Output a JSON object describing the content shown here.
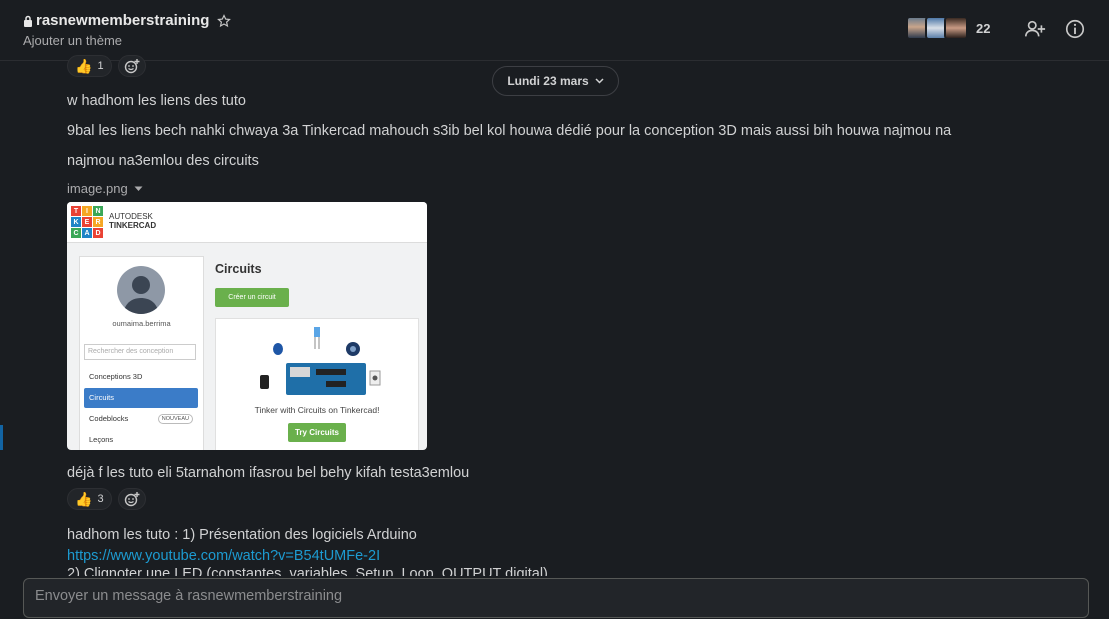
{
  "header": {
    "channel_name": "rasnewmemberstraining",
    "topic": "Ajouter un thème",
    "member_count": "22",
    "icons": [
      "lock-icon",
      "star-icon",
      "add-member-icon",
      "info-icon"
    ]
  },
  "date_divider": "Lundi 23 mars",
  "reactions_top": {
    "emoji": "thumbs-up",
    "count": "1"
  },
  "messages": [
    "w hadhom les liens des tuto",
    "9bal les liens bech nahki chwaya 3a Tinkercad mahouch s3ib bel kol houwa dédié pour la conception 3D mais aussi bih houwa najmou na",
    "najmou na3emlou des circuits",
    "déjà f les tuto eli 5tarnahom ifasrou bel behy kifah testa3emlou",
    "hadhom les tuto : 1) Présentation des logiciels Arduino",
    "2) Clignoter une LED (constantes, variables, Setup, Loop, OUTPUT digital)"
  ],
  "link": "https://www.youtube.com/watch?v=B54tUMFe-2I",
  "attachment": {
    "file_name": "image.png",
    "tinkercad": {
      "logo_letters": [
        "T",
        "I",
        "N",
        "K",
        "E",
        "R",
        "C",
        "A",
        "D"
      ],
      "brand_top": "AUTODESK",
      "brand_bottom": "TINKERCAD",
      "username": "oumaima.berrima",
      "search_placeholder": "Rechercher des conception",
      "nav": [
        "Conceptions 3D",
        "Circuits",
        "Codeblocks",
        "Leçons"
      ],
      "badge": "NOUVEAU",
      "page_title": "Circuits",
      "create_button": "Créer un circuit",
      "card_text": "Tinker with Circuits on Tinkercad!",
      "try_button": "Try Circuits"
    }
  },
  "reactions_bottom": {
    "emoji": "thumbs-up",
    "count": "3"
  },
  "composer": {
    "placeholder": "Envoyer un message à rasnewmemberstraining"
  },
  "colors": {
    "background": "#1a1d21",
    "link": "#1d9bd1",
    "accent": "#1264a3"
  }
}
